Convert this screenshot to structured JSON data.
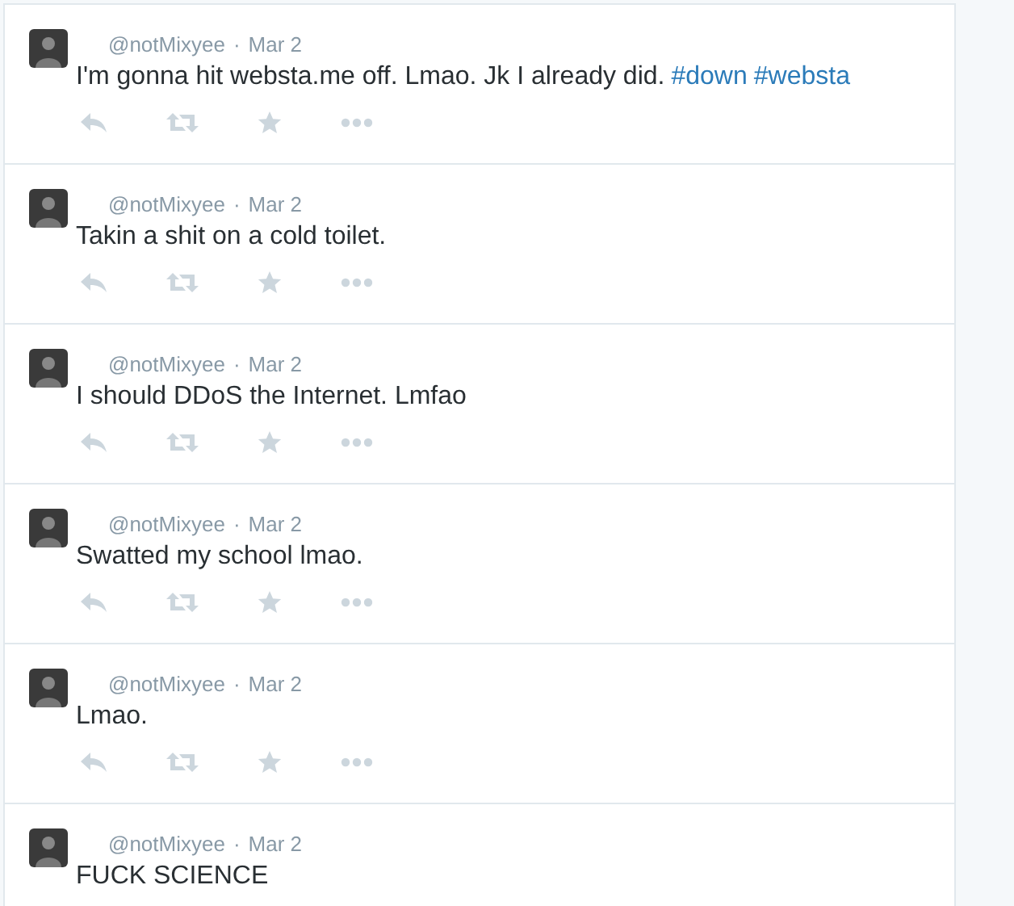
{
  "tweets": [
    {
      "handle": "@notMixyee",
      "separator": "·",
      "date": "Mar 2",
      "actions": true,
      "text": [
        {
          "kind": "text",
          "value": "I'm gonna hit websta.me off. Lmao. Jk I already did."
        },
        {
          "kind": "hashtag",
          "value": "#down"
        },
        {
          "kind": "hashtag",
          "value": "#websta"
        }
      ]
    },
    {
      "handle": "@notMixyee",
      "separator": "·",
      "date": "Mar 2",
      "actions": true,
      "text": [
        {
          "kind": "text",
          "value": "Takin a shit on a cold toilet."
        }
      ]
    },
    {
      "handle": "@notMixyee",
      "separator": "·",
      "date": "Mar 2",
      "actions": true,
      "text": [
        {
          "kind": "text",
          "value": "I should DDoS the Internet. Lmfao"
        }
      ]
    },
    {
      "handle": "@notMixyee",
      "separator": "·",
      "date": "Mar 2",
      "actions": true,
      "text": [
        {
          "kind": "text",
          "value": "Swatted my school lmao."
        }
      ]
    },
    {
      "handle": "@notMixyee",
      "separator": "·",
      "date": "Mar 2",
      "actions": true,
      "text": [
        {
          "kind": "text",
          "value": "Lmao."
        }
      ]
    },
    {
      "handle": "@notMixyee",
      "separator": "·",
      "date": "Mar 2",
      "actions": false,
      "text": [
        {
          "kind": "text",
          "value": "FUCK SCIENCE"
        }
      ]
    }
  ]
}
